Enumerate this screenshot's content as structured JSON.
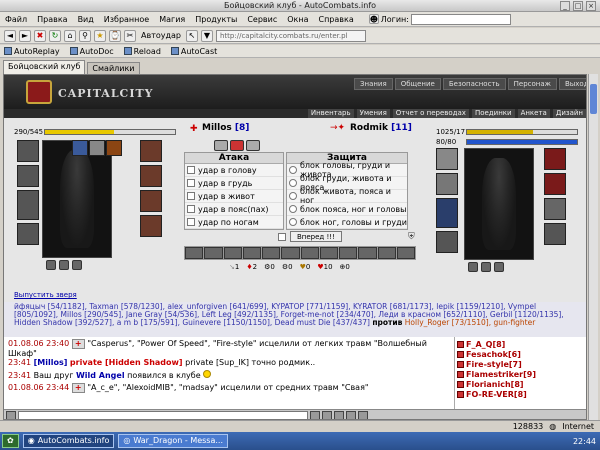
{
  "window": {
    "title": "Бойцовский клуб - AutoCombats.info"
  },
  "menu": {
    "items": [
      "Файл",
      "Правка",
      "Вид",
      "Избранное",
      "Магия",
      "Продукты",
      "Сервис",
      "Окна",
      "Справка"
    ],
    "login_label": "Логин:"
  },
  "nav": {
    "auto_label": "Автоудар",
    "url": "http://capitalcity.combats.ru/enter.pl"
  },
  "bookmarks": [
    {
      "label": "AutoReplay"
    },
    {
      "label": "AutoDoc"
    },
    {
      "label": "Reload"
    },
    {
      "label": "AutoCast"
    }
  ],
  "tabs": [
    {
      "label": "Бойцовский клуб"
    },
    {
      "label": "Смайлики"
    }
  ],
  "game": {
    "logo_text": "CAPITALCITY",
    "header_menu": [
      "Знания",
      "Общение",
      "Безопасность",
      "Персонаж",
      "Выход"
    ],
    "sub_menu": [
      "Инвентарь",
      "Умения",
      "Отчет о переводах",
      "Поединки",
      "Анкета",
      "Дизайн"
    ]
  },
  "player": {
    "name": "Millos",
    "level": "[8]",
    "hp": "290/545",
    "hp_fraction": 0.53,
    "release_label": "Выпустить зверя"
  },
  "enemy": {
    "name": "Rodmik",
    "level": "[11]",
    "hp": "1025/1714",
    "mana": "80/80",
    "hp_fraction": 0.6
  },
  "combat": {
    "attack_title": "Атака",
    "defense_title": "Защита",
    "attacks": [
      "удар в голову",
      "удар в грудь",
      "удар в живот",
      "удар в пояс(пах)",
      "удар по ногам"
    ],
    "defenses": [
      "блок головы, груди и живота",
      "блок груди, живота и пояса",
      "блок живота, пояса и ног",
      "блок пояса, ног и головы",
      "блок ног, головы и груди"
    ],
    "forward_label": "Вперед !!!",
    "counts": [
      "1",
      "2",
      "0",
      "0",
      "0",
      "10",
      "0"
    ]
  },
  "chat_names_html": "йфяцыч [54/1182], Taxman [578/1230], alex_unforgiven [641/699], KYPATOP [771/1159], KYRATOR [681/1173], lepik [1159/1210], Vympel [805/1092], Millos [290/545], Jane Gray [54/536], Left Leg [492/1135], Forget-me-not [234/470], Леди в красном [652/1110], Gerbil [1120/1135], Hidden Shadow [392/527], a m b [175/591], Guinevere [1150/1150], Dead must Die [437/437]",
  "chat_names_tail": {
    "against": "против",
    "rest": "Holly_Roger [73/1510], gun-fighter"
  },
  "chat": [
    {
      "time": "01.08.06 23:40",
      "text": "\"Casperus\", \"Power Of Speed\", \"Fire-style\" исцелили от легких травм \"Волшебный Шкаф\""
    },
    {
      "time": "23:41",
      "who": "[Millos]",
      "priv": "private [Hidden Shadow]",
      "text": "private [Sup_IK] точно родмик.."
    },
    {
      "time": "23:41",
      "text": "Ваш друг",
      "friend": "Wild Angel",
      "text2": "появился в клубе"
    },
    {
      "time": "01.08.06 23:44",
      "text": "\"A_c_e\", \"AlexoidMIB\", \"madsay\" исцелили от средних травм \"Свая\""
    }
  ],
  "online": [
    {
      "name": "F_A_Q[8]"
    },
    {
      "name": "Fesachok[6]"
    },
    {
      "name": "Fire-style[7]"
    },
    {
      "name": "Flamestriker[9]"
    },
    {
      "name": "Florianich[8]"
    },
    {
      "name": "FO-RE-VER[8]"
    }
  ],
  "status": {
    "counter": "128833",
    "zone": "Internet"
  },
  "taskbar": {
    "items": [
      {
        "label": "AutoCombats.info"
      },
      {
        "label": "War_Dragon - Messa..."
      }
    ],
    "clock": "22:44"
  },
  "colors": {
    "hp_bar": "#e8c800",
    "hp_enemy": "#d4b200",
    "mana": "#2255cc",
    "accent": "#8b1a1a"
  }
}
